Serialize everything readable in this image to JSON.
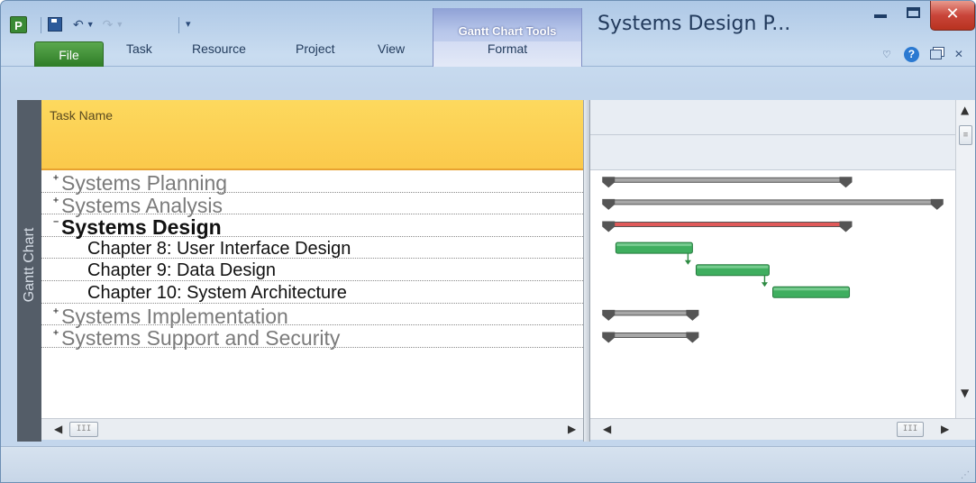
{
  "app": {
    "icon_letter": "P",
    "window_title": "Systems Design P...",
    "context_tab_title": "Gantt Chart Tools",
    "close_glyph": "✕"
  },
  "quick_access": {
    "icons": [
      "save-icon",
      "undo-icon",
      "undo-dropdown-icon",
      "redo-icon",
      "redo-dropdown-icon",
      "customize-qat-icon"
    ]
  },
  "ribbon": {
    "file_tab": "File",
    "tabs": [
      "Task",
      "Resource",
      "Project",
      "View"
    ],
    "context_tab": "Format"
  },
  "side_label": "Gantt Chart",
  "table": {
    "header": "Task Name",
    "rows": [
      {
        "name": "Systems Planning",
        "level": "summary",
        "expanded": false,
        "expand_glyph": "+"
      },
      {
        "name": "Systems Analysis",
        "level": "summary",
        "expanded": false,
        "expand_glyph": "+"
      },
      {
        "name": "Systems Design",
        "level": "summary-active",
        "expanded": true,
        "expand_glyph": "−"
      },
      {
        "name": "Chapter 8: User Interface Design",
        "level": "task"
      },
      {
        "name": "Chapter 9: Data Design",
        "level": "task"
      },
      {
        "name": "Chapter 10: System Architecture",
        "level": "task"
      },
      {
        "name": "Systems Implementation",
        "level": "summary",
        "expanded": false,
        "expand_glyph": "+"
      },
      {
        "name": "Systems Support and Security",
        "level": "summary",
        "expanded": false,
        "expand_glyph": "+"
      }
    ]
  },
  "gantt_bars": [
    {
      "type": "summary",
      "color": "#a7a7a7",
      "start_fraction": 0.05,
      "end_fraction": 0.7
    },
    {
      "type": "summary",
      "color": "#a7a7a7",
      "start_fraction": 0.05,
      "end_fraction": 0.95
    },
    {
      "type": "summary",
      "color": "#e05a5a",
      "start_fraction": 0.05,
      "end_fraction": 0.7
    },
    {
      "type": "task",
      "color": "#3fae5f",
      "start_fraction": 0.07,
      "end_fraction": 0.28
    },
    {
      "type": "task",
      "color": "#3fae5f",
      "start_fraction": 0.29,
      "end_fraction": 0.49
    },
    {
      "type": "task",
      "color": "#3fae5f",
      "start_fraction": 0.5,
      "end_fraction": 0.71
    },
    {
      "type": "summary",
      "color": "#a7a7a7",
      "start_fraction": 0.05,
      "end_fraction": 0.28
    },
    {
      "type": "summary",
      "color": "#a7a7a7",
      "start_fraction": 0.05,
      "end_fraction": 0.28
    }
  ],
  "colors": {
    "file_tab": "#3a8f31",
    "header_fill": "#fcd356",
    "critical": "#e05a5a",
    "task_bar": "#3fae5f",
    "summary_bar": "#a7a7a7"
  }
}
